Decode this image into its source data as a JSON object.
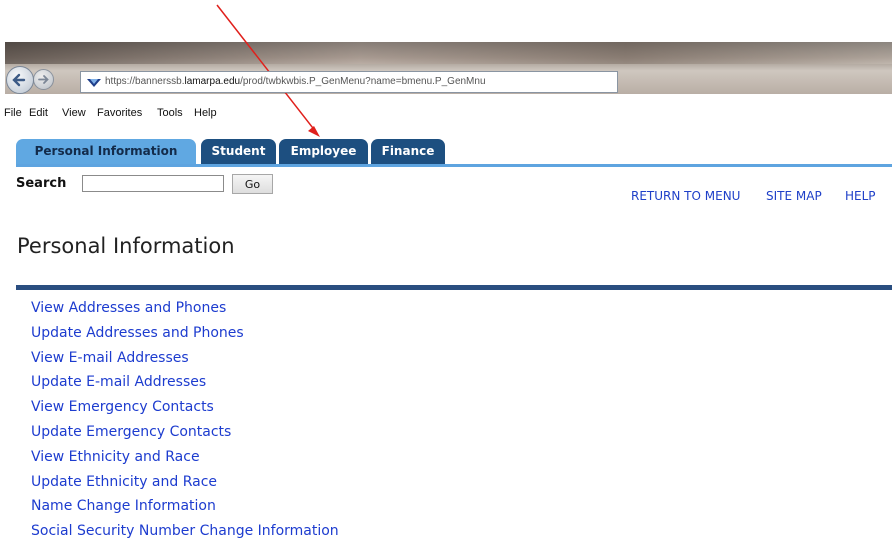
{
  "browser": {
    "url_prefix": "https://bannerssb.",
    "url_domain": "lamarpa.edu",
    "url_path": "/prod/twbkwbis.P_GenMenu?name=bmenu.P_GenMnu"
  },
  "menubar": {
    "items": [
      "File",
      "Edit",
      "View",
      "Favorites",
      "Tools",
      "Help"
    ]
  },
  "tabs": [
    {
      "label": "Personal Information",
      "active": true
    },
    {
      "label": "Student",
      "active": false
    },
    {
      "label": "Employee",
      "active": false
    },
    {
      "label": "Finance",
      "active": false
    }
  ],
  "search": {
    "label": "Search",
    "value": "",
    "button": "Go"
  },
  "top_links": [
    "RETURN TO MENU",
    "SITE MAP",
    "HELP"
  ],
  "page_title": "Personal Information",
  "menu_links": [
    "View Addresses and Phones",
    "Update Addresses and Phones",
    "View E-mail Addresses",
    "Update E-mail Addresses",
    "View Emergency Contacts",
    "Update Emergency Contacts",
    "View Ethnicity and Race",
    "Update Ethnicity and Race",
    "Name Change Information",
    "Social Security Number Change Information"
  ],
  "colors": {
    "tab": "#1d4f80",
    "tab_active": "#60a8e2",
    "link": "#1d3ccf",
    "rule": "#2a4e80",
    "annotation_arrow": "#e0201c"
  }
}
